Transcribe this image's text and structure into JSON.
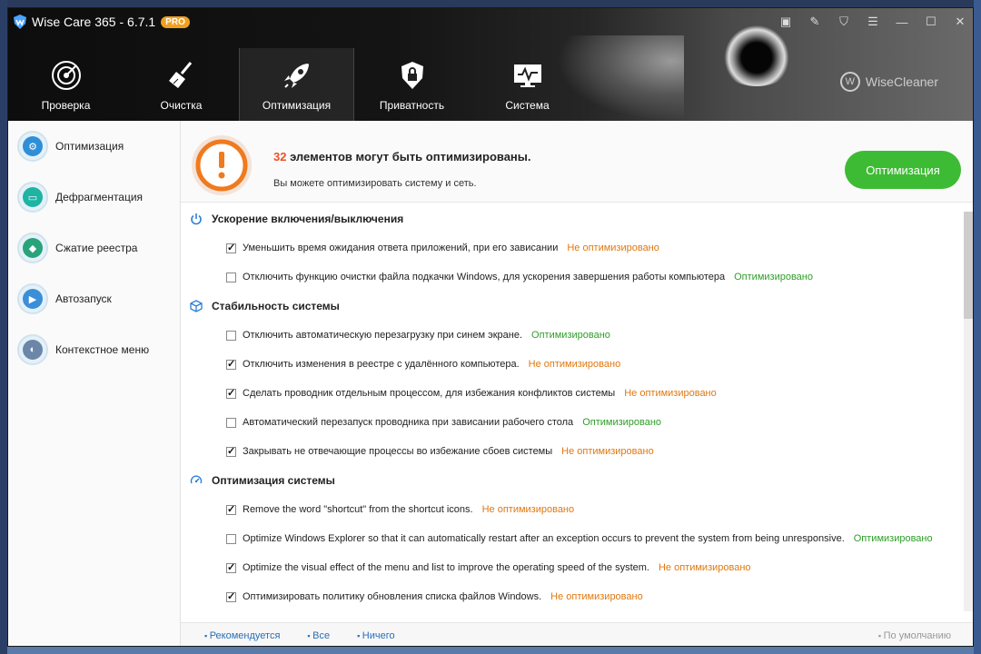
{
  "window": {
    "title": "Wise Care 365 - 6.7.1",
    "badge": "PRO",
    "brand": "WiseCleaner"
  },
  "nav": [
    {
      "label": "Проверка",
      "icon": "radar-icon"
    },
    {
      "label": "Очистка",
      "icon": "broom-icon"
    },
    {
      "label": "Оптимизация",
      "icon": "rocket-icon"
    },
    {
      "label": "Приватность",
      "icon": "lock-icon"
    },
    {
      "label": "Система",
      "icon": "monitor-icon"
    }
  ],
  "sidebar": [
    {
      "label": "Оптимизация",
      "icon": "gear-icon"
    },
    {
      "label": "Дефрагментация",
      "icon": "drive-icon"
    },
    {
      "label": "Сжатие реестра",
      "icon": "registry-icon"
    },
    {
      "label": "Автозапуск",
      "icon": "play-icon"
    },
    {
      "label": "Контекстное меню",
      "icon": "mouse-icon"
    }
  ],
  "banner": {
    "count": "32",
    "title_rest": " элементов могут быть оптимизированы.",
    "subtitle": "Вы можете оптимизировать систему и сеть.",
    "button": "Оптимизация"
  },
  "sections": [
    {
      "title": "Ускорение включения/выключения",
      "icon": "power-icon",
      "items": [
        {
          "text": "Уменьшить время ожидания ответа приложений, при его зависании",
          "checked": true,
          "status": "Не оптимизировано"
        },
        {
          "text": "Отключить функцию очистки файла подкачки Windows, для ускорения завершения работы компьютера",
          "checked": false,
          "status": "Оптимизировано"
        }
      ]
    },
    {
      "title": "Стабильность системы",
      "icon": "cube-icon",
      "items": [
        {
          "text": "Отключить автоматическую перезагрузку при синем экране.",
          "checked": false,
          "status": "Оптимизировано"
        },
        {
          "text": "Отключить изменения в реестре с удалённого компьютера.",
          "checked": true,
          "status": "Не оптимизировано"
        },
        {
          "text": "Сделать проводник отдельным процессом, для избежания конфликтов системы",
          "checked": true,
          "status": "Не оптимизировано"
        },
        {
          "text": "Автоматический перезапуск проводника при зависании рабочего стола",
          "checked": false,
          "status": "Оптимизировано"
        },
        {
          "text": "Закрывать не отвечающие процессы во избежание сбоев системы",
          "checked": true,
          "status": "Не оптимизировано"
        }
      ]
    },
    {
      "title": "Оптимизация системы",
      "icon": "speedometer-icon",
      "items": [
        {
          "text": "Remove the word \"shortcut\" from the shortcut icons.",
          "checked": true,
          "status": "Не оптимизировано"
        },
        {
          "text": "Optimize Windows Explorer so that it can automatically restart after an exception occurs to prevent the system from being unresponsive.",
          "checked": false,
          "status": "Оптимизировано"
        },
        {
          "text": "Optimize the visual effect of the menu and list to improve the operating speed of the system.",
          "checked": true,
          "status": "Не оптимизировано"
        },
        {
          "text": "Оптимизировать политику обновления списка файлов Windows.",
          "checked": true,
          "status": "Не оптимизировано"
        }
      ]
    }
  ],
  "footer": {
    "recommended": "Рекомендуется",
    "all": "Все",
    "none": "Ничего",
    "default": "По умолчанию"
  },
  "colors": {
    "accent_green": "#3dbb34",
    "warning_orange": "#e8532a",
    "not_optimized": "#e07810",
    "optimized": "#2e9e28",
    "link": "#2a6fb8"
  }
}
